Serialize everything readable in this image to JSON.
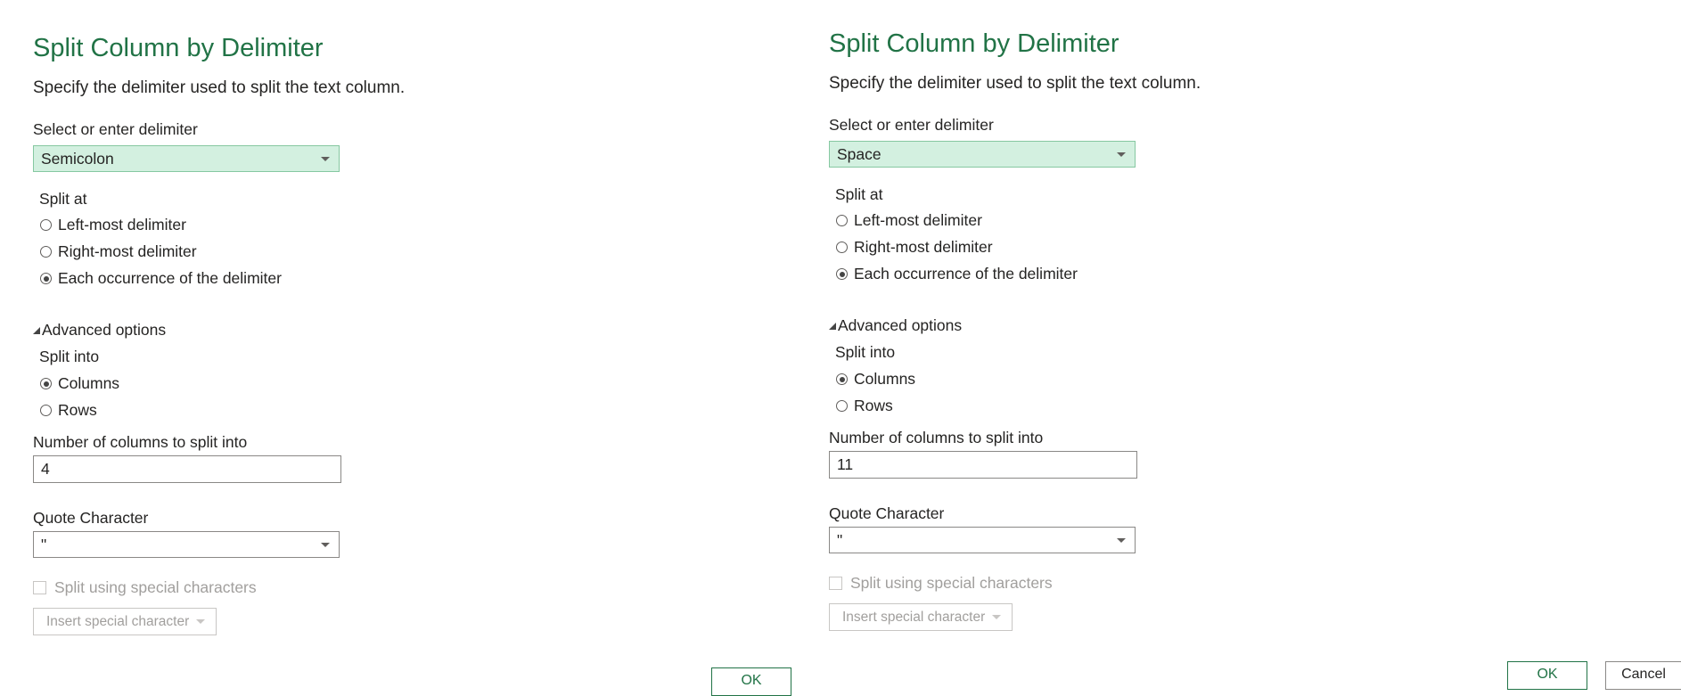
{
  "dialogs": [
    {
      "title": "Split Column by Delimiter",
      "description": "Specify the delimiter used to split the text column.",
      "delimiter_label": "Select or enter delimiter",
      "delimiter_value": "Semicolon",
      "split_at_label": "Split at",
      "split_at_options": [
        "Left-most delimiter",
        "Right-most delimiter",
        "Each occurrence of the delimiter"
      ],
      "split_at_selected": "Each occurrence of the delimiter",
      "advanced_label": "Advanced options",
      "split_into_label": "Split into",
      "split_into_options": [
        "Columns",
        "Rows"
      ],
      "split_into_selected": "Columns",
      "num_columns_label": "Number of columns to split into",
      "num_columns_value": "4",
      "quote_label": "Quote Character",
      "quote_value": "\"",
      "special_chars_label": "Split using special characters",
      "insert_special_label": "Insert special character",
      "ok_label": "OK"
    },
    {
      "title": "Split Column by Delimiter",
      "description": "Specify the delimiter used to split the text column.",
      "delimiter_label": "Select or enter delimiter",
      "delimiter_value": "Space",
      "split_at_label": "Split at",
      "split_at_options": [
        "Left-most delimiter",
        "Right-most delimiter",
        "Each occurrence of the delimiter"
      ],
      "split_at_selected": "Each occurrence of the delimiter",
      "advanced_label": "Advanced options",
      "split_into_label": "Split into",
      "split_into_options": [
        "Columns",
        "Rows"
      ],
      "split_into_selected": "Columns",
      "num_columns_label": "Number of columns to split into",
      "num_columns_value": "11",
      "quote_label": "Quote Character",
      "quote_value": "\"",
      "special_chars_label": "Split using special characters",
      "insert_special_label": "Insert special character",
      "ok_label": "OK",
      "cancel_label": "Cancel"
    }
  ],
  "colors": {
    "accent": "#217346",
    "selected_dropdown_bg": "#d3f0e0",
    "disabled_text": "#a19f9d"
  },
  "icons": {
    "dropdown": "chevron-down-icon",
    "advanced_toggle": "expanded-triangle-icon",
    "radio": "radio-button-icon",
    "checkbox": "checkbox-icon"
  }
}
